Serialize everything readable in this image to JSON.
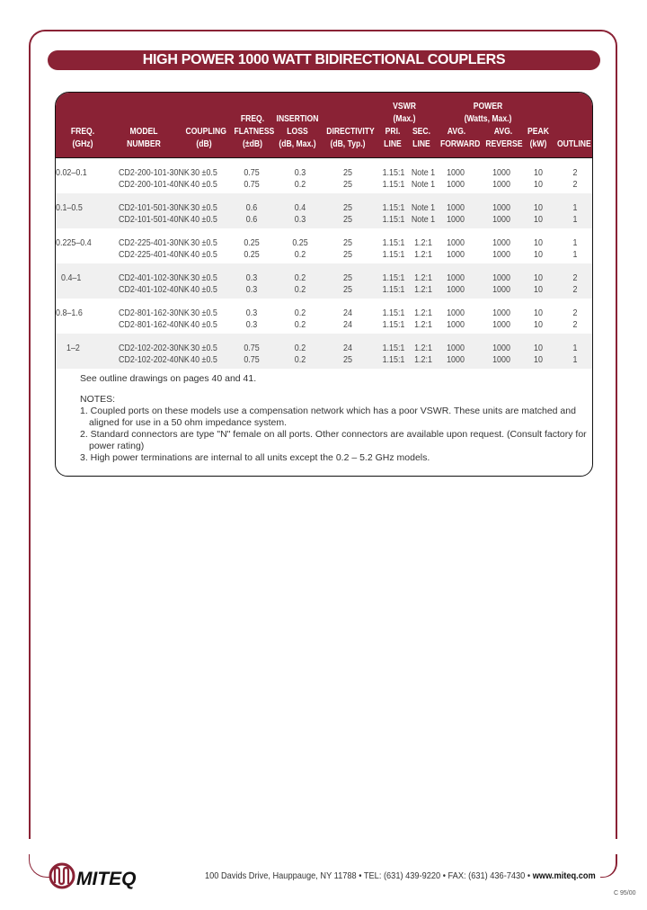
{
  "title": "HIGH POWER 1000 WATT BIDIRECTIONAL COUPLERS",
  "table": {
    "headers": {
      "freq": [
        "FREQ.",
        "(GHz)"
      ],
      "model": [
        "MODEL",
        "NUMBER"
      ],
      "coupling": [
        "COUPLING",
        "(dB)"
      ],
      "flatness": [
        "FREQ.",
        "FLATNESS",
        "(±dB)"
      ],
      "insertion": [
        "INSERTION",
        "LOSS",
        "(dB, Max.)"
      ],
      "directivity": [
        "DIRECTIVITY",
        "(dB, Typ.)"
      ],
      "vswr_group": [
        "VSWR",
        "(Max.)"
      ],
      "vswr_pri": [
        "PRI.",
        "LINE"
      ],
      "vswr_sec": [
        "SEC.",
        "LINE"
      ],
      "power_group": [
        "POWER",
        "(Watts, Max.)"
      ],
      "avg_fwd": [
        "AVG.",
        "FORWARD"
      ],
      "avg_rev": [
        "AVG.",
        "REVERSE"
      ],
      "peak": [
        "PEAK",
        "(kW)"
      ],
      "outline": [
        "OUTLINE"
      ]
    },
    "groups": [
      {
        "freq": "0.02–0.1",
        "rows": [
          {
            "model": "CD2-200-101-30NK",
            "coupling": "30 ±0.5",
            "flatness": "0.75",
            "insertion": "0.3",
            "directivity": "25",
            "pri": "1.15:1",
            "sec": "Note 1",
            "fwd": "1000",
            "rev": "1000",
            "peak": "10",
            "outline": "2"
          },
          {
            "model": "CD2-200-101-40NK",
            "coupling": "40 ±0.5",
            "flatness": "0.75",
            "insertion": "0.2",
            "directivity": "25",
            "pri": "1.15:1",
            "sec": "Note 1",
            "fwd": "1000",
            "rev": "1000",
            "peak": "10",
            "outline": "2"
          }
        ]
      },
      {
        "freq": "0.1–0.5",
        "rows": [
          {
            "model": "CD2-101-501-30NK",
            "coupling": "30 ±0.5",
            "flatness": "0.6",
            "insertion": "0.4",
            "directivity": "25",
            "pri": "1.15:1",
            "sec": "Note 1",
            "fwd": "1000",
            "rev": "1000",
            "peak": "10",
            "outline": "1"
          },
          {
            "model": "CD2-101-501-40NK",
            "coupling": "40 ±0.5",
            "flatness": "0.6",
            "insertion": "0.3",
            "directivity": "25",
            "pri": "1.15:1",
            "sec": "Note 1",
            "fwd": "1000",
            "rev": "1000",
            "peak": "10",
            "outline": "1"
          }
        ]
      },
      {
        "freq": "0.225–0.4",
        "rows": [
          {
            "model": "CD2-225-401-30NK",
            "coupling": "30 ±0.5",
            "flatness": "0.25",
            "insertion": "0.25",
            "directivity": "25",
            "pri": "1.15:1",
            "sec": "1.2:1",
            "fwd": "1000",
            "rev": "1000",
            "peak": "10",
            "outline": "1"
          },
          {
            "model": "CD2-225-401-40NK",
            "coupling": "40 ±0.5",
            "flatness": "0.25",
            "insertion": "0.2",
            "directivity": "25",
            "pri": "1.15:1",
            "sec": "1.2:1",
            "fwd": "1000",
            "rev": "1000",
            "peak": "10",
            "outline": "1"
          }
        ]
      },
      {
        "freq": "0.4–1",
        "rows": [
          {
            "model": "CD2-401-102-30NK",
            "coupling": "30 ±0.5",
            "flatness": "0.3",
            "insertion": "0.2",
            "directivity": "25",
            "pri": "1.15:1",
            "sec": "1.2:1",
            "fwd": "1000",
            "rev": "1000",
            "peak": "10",
            "outline": "2"
          },
          {
            "model": "CD2-401-102-40NK",
            "coupling": "40 ±0.5",
            "flatness": "0.3",
            "insertion": "0.2",
            "directivity": "25",
            "pri": "1.15:1",
            "sec": "1.2:1",
            "fwd": "1000",
            "rev": "1000",
            "peak": "10",
            "outline": "2"
          }
        ]
      },
      {
        "freq": "0.8–1.6",
        "rows": [
          {
            "model": "CD2-801-162-30NK",
            "coupling": "30 ±0.5",
            "flatness": "0.3",
            "insertion": "0.2",
            "directivity": "24",
            "pri": "1.15:1",
            "sec": "1.2:1",
            "fwd": "1000",
            "rev": "1000",
            "peak": "10",
            "outline": "2"
          },
          {
            "model": "CD2-801-162-40NK",
            "coupling": "40 ±0.5",
            "flatness": "0.3",
            "insertion": "0.2",
            "directivity": "24",
            "pri": "1.15:1",
            "sec": "1.2:1",
            "fwd": "1000",
            "rev": "1000",
            "peak": "10",
            "outline": "2"
          }
        ]
      },
      {
        "freq": "1–2",
        "rows": [
          {
            "model": "CD2-102-202-30NK",
            "coupling": "30 ±0.5",
            "flatness": "0.75",
            "insertion": "0.2",
            "directivity": "24",
            "pri": "1.15:1",
            "sec": "1.2:1",
            "fwd": "1000",
            "rev": "1000",
            "peak": "10",
            "outline": "1"
          },
          {
            "model": "CD2-102-202-40NK",
            "coupling": "40 ±0.5",
            "flatness": "0.75",
            "insertion": "0.2",
            "directivity": "25",
            "pri": "1.15:1",
            "sec": "1.2:1",
            "fwd": "1000",
            "rev": "1000",
            "peak": "10",
            "outline": "1"
          }
        ]
      }
    ]
  },
  "notes": {
    "see_outline": "See outline drawings on pages 40 and 41.",
    "heading": "NOTES:",
    "items": [
      "1. Coupled ports on these models use a compensation network which has a poor VSWR. These units are matched and aligned for use in a 50 ohm impedance system.",
      "2. Standard connectors are type \"N\" female on all ports. Other connectors are available upon request. (Consult factory for power rating)",
      "3. High power terminations are internal to all units except the 0.2 – 5.2 GHz models."
    ]
  },
  "footer": {
    "brand": "MITEQ",
    "address": "100 Davids Drive, Hauppauge, NY 11788",
    "tel": "TEL: (631) 439-9220",
    "fax": "FAX: (631) 436-7430",
    "url": "www.miteq.com",
    "separator": "•",
    "page_code": "C 95/00"
  },
  "colors": {
    "brand": "#8a2235",
    "row_alt": "#f0f0f0",
    "border": "#111111"
  }
}
